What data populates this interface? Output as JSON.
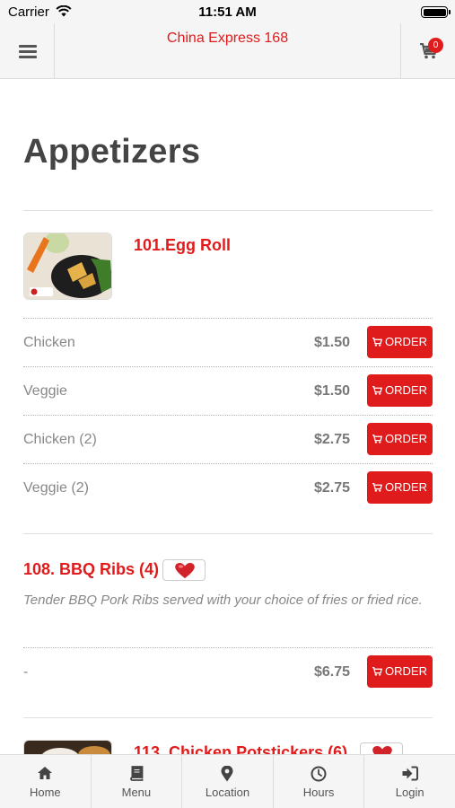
{
  "status_bar": {
    "carrier": "Carrier",
    "time": "11:51 AM"
  },
  "header": {
    "title": "China Express 168",
    "cart_count": "0"
  },
  "section": {
    "title": "Appetizers"
  },
  "items": [
    {
      "name": "101.Egg Roll",
      "options": [
        {
          "label": "Chicken",
          "price": "$1.50",
          "button": "ORDER"
        },
        {
          "label": "Veggie",
          "price": "$1.50",
          "button": "ORDER"
        },
        {
          "label": "Chicken (2)",
          "price": "$2.75",
          "button": "ORDER"
        },
        {
          "label": "Veggie (2)",
          "price": "$2.75",
          "button": "ORDER"
        }
      ]
    },
    {
      "name": "108. BBQ Ribs (4)",
      "description": "Tender BBQ Pork Ribs served with your choice of fries or fried rice.",
      "options": [
        {
          "label": "-",
          "price": "$6.75",
          "button": "ORDER"
        }
      ]
    },
    {
      "name": "113. Chicken Potstickers (6)"
    }
  ],
  "tabbar": {
    "tabs": [
      {
        "label": "Home",
        "icon": "home-icon"
      },
      {
        "label": "Menu",
        "icon": "book-icon"
      },
      {
        "label": "Location",
        "icon": "map-pin-icon"
      },
      {
        "label": "Hours",
        "icon": "clock-icon"
      },
      {
        "label": "Login",
        "icon": "login-icon"
      }
    ]
  },
  "colors": {
    "accent": "#e01b1b",
    "bar_bg": "#f5f5f5",
    "text_muted": "#888888"
  }
}
